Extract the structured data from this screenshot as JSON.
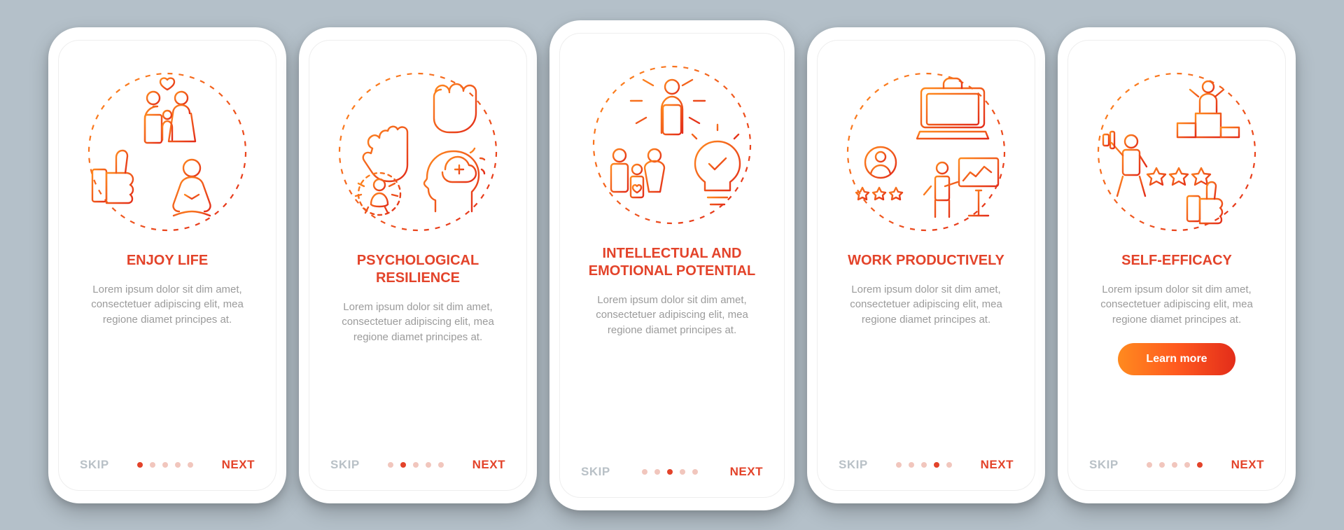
{
  "common": {
    "skip": "SKIP",
    "next": "NEXT",
    "description": "Lorem ipsum dolor sit dim amet, consectetuer adipiscing elit, mea regione diamet principes at."
  },
  "colors": {
    "accent": "#e3432a",
    "gradient_start": "#ff8a1f",
    "gradient_end": "#e32d1a",
    "muted": "#9b9b9b",
    "dot_inactive": "#f1c6bd"
  },
  "cta": {
    "label": "Learn more"
  },
  "screens": [
    {
      "title": "Enjoy Life",
      "icon": "enjoy-life-icon",
      "active_index": 0,
      "dot_count": 5,
      "has_cta": false
    },
    {
      "title": "Psychological Resilience",
      "icon": "psychological-resilience-icon",
      "active_index": 1,
      "dot_count": 5,
      "has_cta": false
    },
    {
      "title": "Intellectual and Emotional Potential",
      "icon": "intellectual-emotional-icon",
      "active_index": 2,
      "dot_count": 5,
      "has_cta": false
    },
    {
      "title": "Work Productively",
      "icon": "work-productively-icon",
      "active_index": 3,
      "dot_count": 5,
      "has_cta": false
    },
    {
      "title": "Self-Efficacy",
      "icon": "self-efficacy-icon",
      "active_index": 4,
      "dot_count": 5,
      "has_cta": true
    }
  ]
}
